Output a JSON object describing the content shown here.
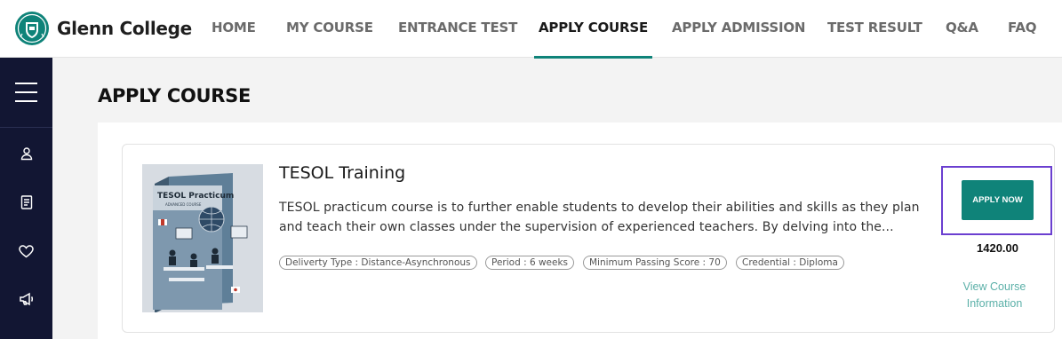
{
  "brand": {
    "name": "Glenn College"
  },
  "nav": {
    "items": [
      {
        "label": "HOME"
      },
      {
        "label": "MY COURSE"
      },
      {
        "label": "ENTRANCE TEST"
      },
      {
        "label": "APPLY COURSE",
        "active": true
      },
      {
        "label": "APPLY ADMISSION"
      },
      {
        "label": "TEST RESULT"
      },
      {
        "label": "Q&A"
      },
      {
        "label": "FAQ"
      }
    ]
  },
  "sidebar": {
    "icons": [
      "user-icon",
      "document-icon",
      "heart-icon",
      "megaphone-icon"
    ]
  },
  "page": {
    "title": "APPLY COURSE"
  },
  "course": {
    "title": "TESOL Training",
    "description": "TESOL practicum course is to further enable students to develop their abilities and skills as they plan and teach their own classes under the supervision of experienced teachers. By delving into the...",
    "cover_title": "TESOL Practicum",
    "cover_subtitle": "ADVANCED COURSE",
    "tags": [
      "Deliverty Type : Distance-Asynchronous",
      "Period : 6 weeks",
      "Minimum Passing Score : 70",
      "Credential : Diploma"
    ],
    "apply_label": "APPLY NOW",
    "price": "1420.00",
    "view_link": "View Course Information"
  },
  "colors": {
    "accent": "#0f8379",
    "sidebar_bg": "#121633",
    "highlight_frame": "#6b3fd0",
    "link": "#5bb0a8"
  }
}
